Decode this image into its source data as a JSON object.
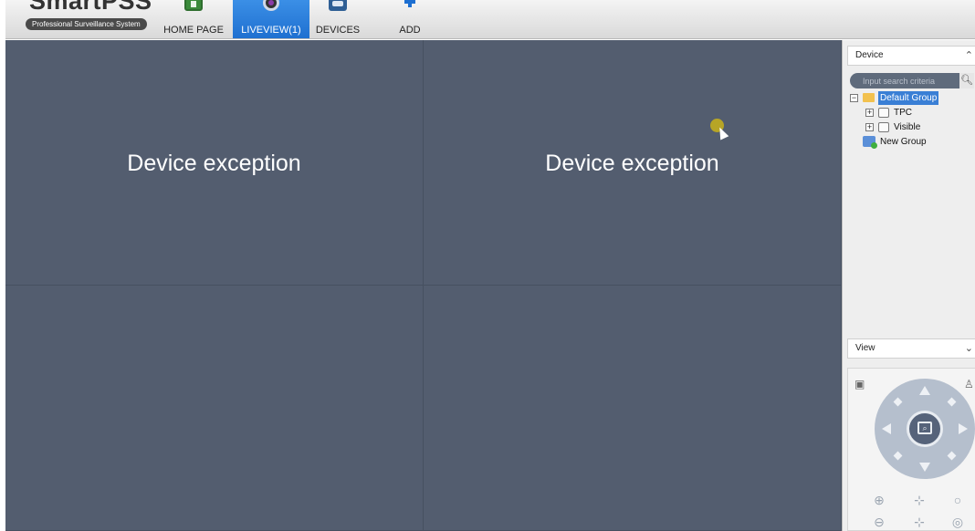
{
  "app": {
    "logo_text": "SmartPSS",
    "logo_subtitle": "Professional Surveillance System"
  },
  "nav": {
    "tabs": [
      {
        "label": "HOME PAGE",
        "icon": "home-icon",
        "active": false
      },
      {
        "label": "LIVEVIEW(1)",
        "icon": "liveview-icon",
        "active": true
      },
      {
        "label": "DEVICES",
        "icon": "devices-icon",
        "active": false
      },
      {
        "label": "ADD",
        "icon": "add-icon",
        "active": false
      }
    ]
  },
  "video_grid": {
    "panes": [
      {
        "message": "Device exception"
      },
      {
        "message": "Device exception"
      },
      {
        "message": ""
      },
      {
        "message": ""
      }
    ]
  },
  "device_panel": {
    "title": "Device",
    "collapse_icon": "chevron-up-icon",
    "search": {
      "placeholder": "Input search criteria",
      "icon": "search-icon"
    },
    "tree": {
      "root": {
        "label": "Default Group",
        "expanded": true,
        "selected": true
      },
      "children": [
        {
          "label": "TPC",
          "expanded": false
        },
        {
          "label": "Visible",
          "expanded": false
        }
      ],
      "new_group": {
        "label": "New Group"
      }
    }
  },
  "view_panel": {
    "title": "View",
    "expand_icon": "chevron-down-icon",
    "ptz": {
      "center_icon": "zoom-area-icon",
      "top_left_icon": "grid-icon",
      "top_right_icon": "person-icon",
      "bottom_buttons": [
        "zoom-icon",
        "focus-icon",
        "iris-icon"
      ]
    }
  },
  "colors": {
    "video_background": "#535d6f",
    "active_tab": "#1e6fd0",
    "tree_selected": "#3a7fd5"
  }
}
